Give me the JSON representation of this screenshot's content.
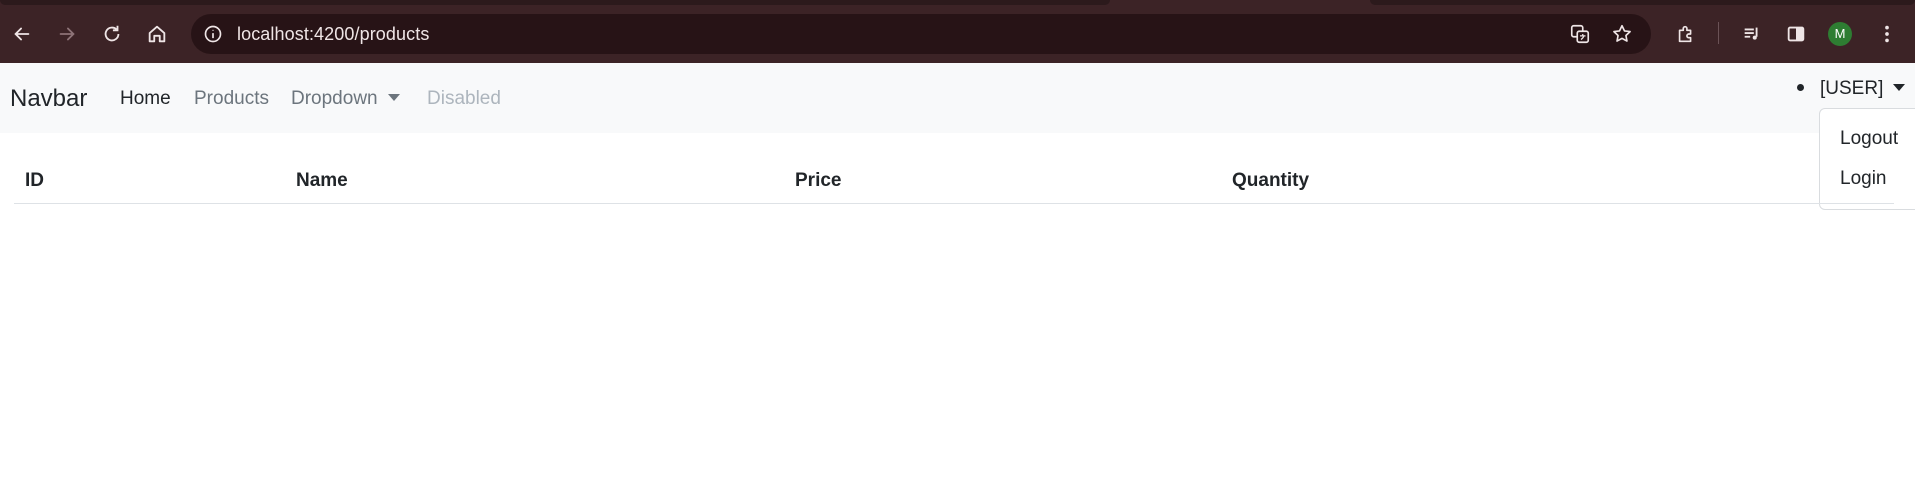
{
  "browser": {
    "url": "localhost:4200/products",
    "profile_initial": "M"
  },
  "navbar": {
    "brand": "Navbar",
    "links": {
      "home": "Home",
      "products": "Products",
      "dropdown": "Dropdown",
      "disabled": "Disabled"
    },
    "user_label": "[USER]",
    "user_menu": [
      "Logout",
      "Login"
    ]
  },
  "table": {
    "headers": [
      "ID",
      "Name",
      "Price",
      "Quantity"
    ],
    "rows": []
  },
  "colors": {
    "chrome": "#3c2326",
    "omnibox": "#271316",
    "navbar_bg": "#f8f9fa",
    "avatar": "#2e7d32"
  }
}
